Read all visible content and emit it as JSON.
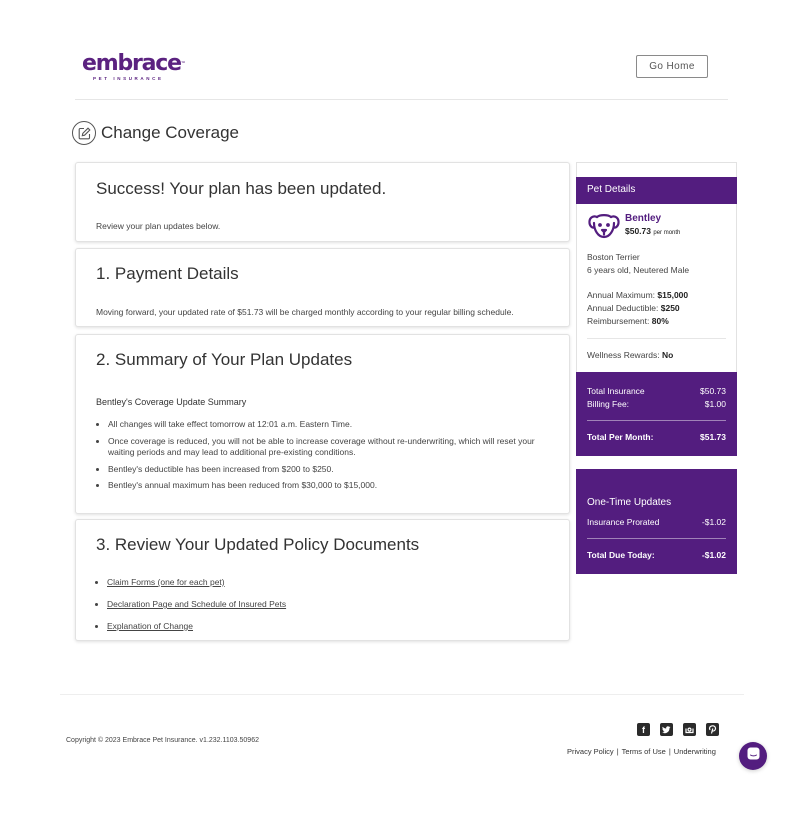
{
  "header": {
    "logo_word": "embrace",
    "logo_tm": "™",
    "logo_sub": "PET INSURANCE",
    "go_home_label": "Go Home"
  },
  "page": {
    "title": "Change Coverage",
    "title_icon": "edit-icon"
  },
  "success": {
    "heading": "Success! Your plan has been updated.",
    "body": "Review your plan updates below."
  },
  "payment": {
    "heading": "1. Payment Details",
    "body": "Moving forward, your updated rate of $51.73 will be charged monthly according to your regular billing schedule."
  },
  "summary": {
    "heading": "2. Summary of Your Plan Updates",
    "subheading": "Bentley's Coverage Update Summary",
    "items": [
      "All changes will take effect tomorrow at 12:01 a.m. Eastern Time.",
      "Once coverage is reduced, you will not be able to increase coverage without re-underwriting, which will reset your waiting periods and may lead to additional pre-existing conditions.",
      "Bentley's deductible has been increased from $200 to $250.",
      "Bentley's annual maximum has been reduced from $30,000 to $15,000."
    ]
  },
  "documents": {
    "heading": "3. Review Your Updated Policy Documents",
    "links": [
      "Claim Forms (one for each pet)",
      "Declaration Page and Schedule of Insured Pets",
      "Explanation of Change"
    ]
  },
  "pet_details": {
    "header": "Pet Details",
    "icon": "dog-icon",
    "name": "Bentley",
    "price": "$50.73",
    "price_suffix": "per month",
    "breed": "Boston Terrier",
    "age_sex": "6 years old, Neutered Male",
    "annual_max_label": "Annual Maximum:",
    "annual_max_value": "$15,000",
    "deductible_label": "Annual Deductible:",
    "deductible_value": "$250",
    "reimbursement_label": "Reimbursement:",
    "reimbursement_value": "80%",
    "wellness_label": "Wellness Rewards:",
    "wellness_value": "No"
  },
  "totals": {
    "insurance_label": "Total Insurance",
    "insurance_value": "$50.73",
    "billing_label": "Billing Fee:",
    "billing_value": "$1.00",
    "total_label": "Total Per Month:",
    "total_value": "$51.73"
  },
  "one_time": {
    "title": "One-Time Updates",
    "prorated_label": "Insurance Prorated",
    "prorated_value": "-$1.02",
    "due_label": "Total Due Today:",
    "due_value": "-$1.02"
  },
  "footer": {
    "copyright": "Copyright © 2023   Embrace Pet Insurance. v1.232.1103.50962",
    "social": [
      "facebook-icon",
      "twitter-icon",
      "instagram-icon",
      "pinterest-icon"
    ],
    "links": [
      "Privacy Policy",
      "Terms of Use",
      "Underwriting"
    ],
    "separator": "|"
  },
  "colors": {
    "brand_purple": "#531d7f",
    "text": "#3b3b3b"
  }
}
